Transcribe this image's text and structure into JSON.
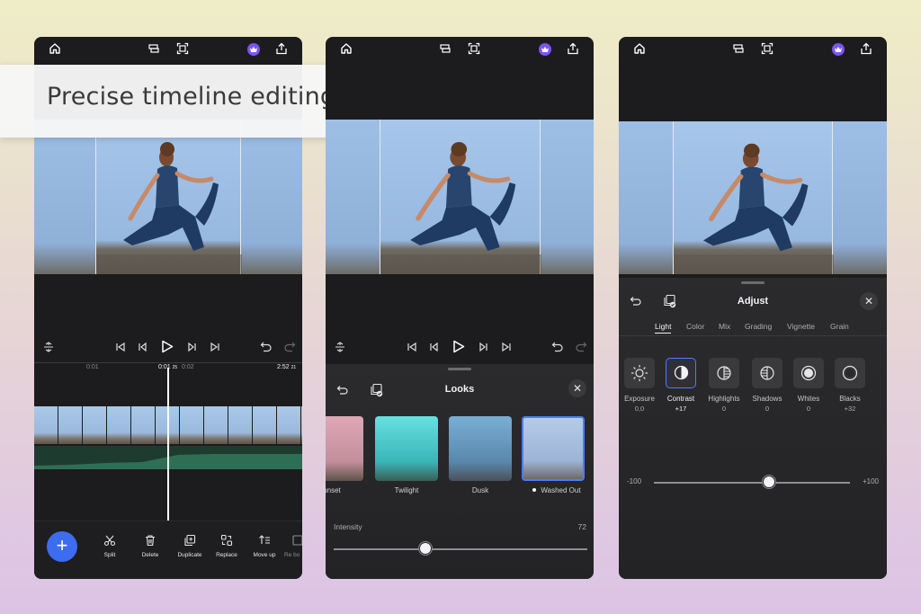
{
  "caption": "Precise timeline editing",
  "screen1": {
    "ruler": {
      "t1": "0:01",
      "current_main": "0:01",
      "current_frame": "25",
      "t2": "0:02",
      "end_main": "2:52",
      "end_frame": "21"
    },
    "tools": [
      {
        "label": "Split",
        "icon": "scissors-icon"
      },
      {
        "label": "Delete",
        "icon": "trash-icon"
      },
      {
        "label": "Duplicate",
        "icon": "duplicate-icon"
      },
      {
        "label": "Replace",
        "icon": "replace-icon"
      },
      {
        "label": "Move up",
        "icon": "move-up-icon"
      }
    ],
    "partial_tool": "Re bo",
    "add_label": "+"
  },
  "screen2": {
    "sheet_title": "Looks",
    "looks": [
      {
        "name": "unset",
        "tint": "#c89aa4"
      },
      {
        "name": "Twilight",
        "tint": "#47c6c9"
      },
      {
        "name": "Dusk",
        "tint": "#5b8eb4"
      },
      {
        "name": "Washed Out",
        "tint": "#9db4d8",
        "selected": true
      }
    ],
    "intensity_label": "Intensity",
    "intensity_value": "72",
    "intensity_fraction": 0.36
  },
  "screen3": {
    "sheet_title": "Adjust",
    "tabs": [
      "Light",
      "Color",
      "Mix",
      "Grading",
      "Vignette",
      "Grain"
    ],
    "active_tab": "Light",
    "adjustments": [
      {
        "label": "Exposure",
        "value": "0,0",
        "icon": "sun-icon"
      },
      {
        "label": "Contrast",
        "value": "+17",
        "icon": "contrast-icon",
        "selected": true
      },
      {
        "label": "Highlights",
        "value": "0",
        "icon": "highlights-icon"
      },
      {
        "label": "Shadows",
        "value": "0",
        "icon": "shadows-icon"
      },
      {
        "label": "Whites",
        "value": "0",
        "icon": "whites-icon"
      },
      {
        "label": "Blacks",
        "value": "+32",
        "icon": "blacks-icon"
      }
    ],
    "slider_min": "-100",
    "slider_max": "+100",
    "slider_value": 17
  },
  "colors": {
    "accent": "#3e6cf0",
    "premium": "#7b55f0",
    "audio": "#1e3b30"
  }
}
